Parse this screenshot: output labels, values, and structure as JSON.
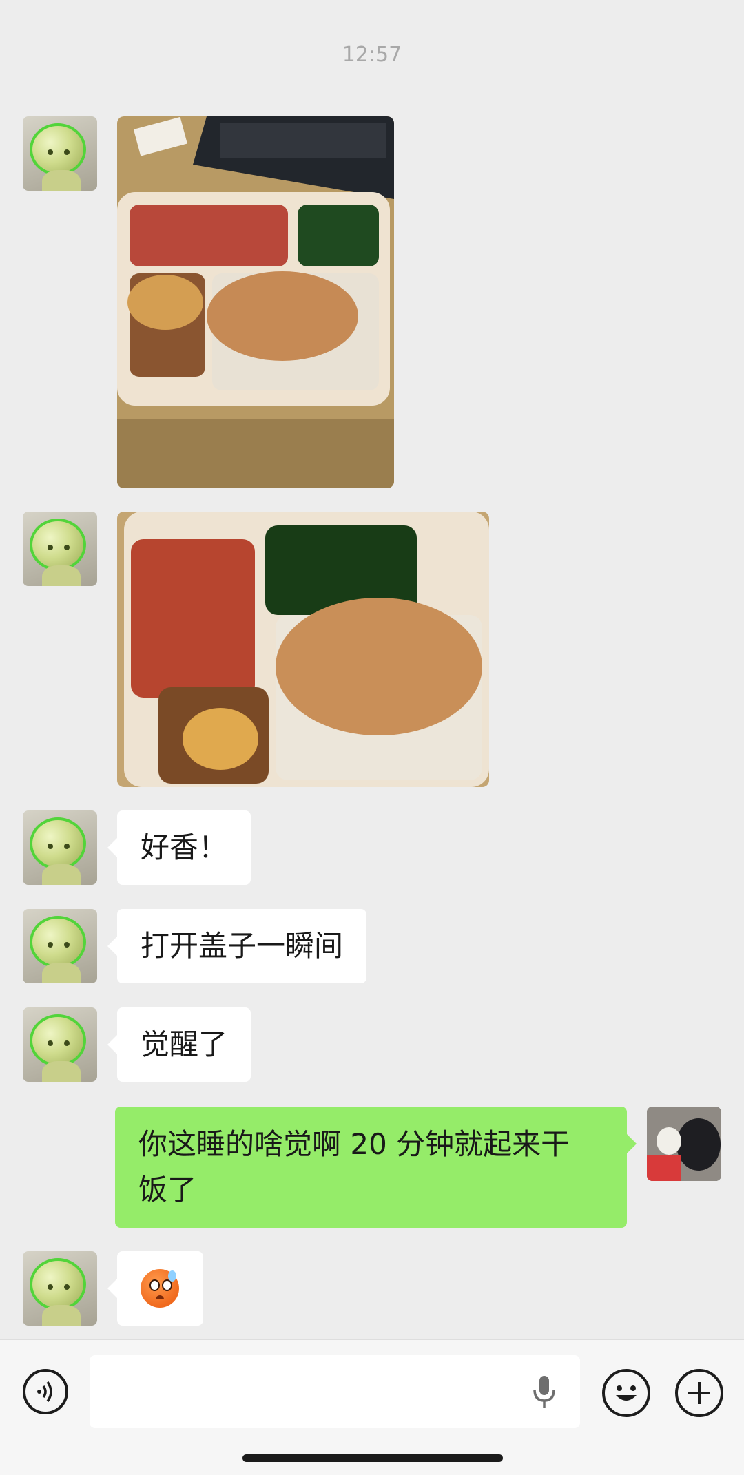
{
  "timestamp": "12:57",
  "messages": [
    {
      "side": "left",
      "type": "image",
      "alt": "food-photo-1"
    },
    {
      "side": "left",
      "type": "image",
      "alt": "food-photo-2"
    },
    {
      "side": "left",
      "type": "text",
      "text": "好香！"
    },
    {
      "side": "left",
      "type": "text",
      "text": "打开盖子一瞬间"
    },
    {
      "side": "left",
      "type": "text",
      "text": "觉醒了"
    },
    {
      "side": "right",
      "type": "text",
      "line1": "你这睡的啥觉啊 20 分钟就起来干",
      "line2": "饭了"
    },
    {
      "side": "left",
      "type": "emoji",
      "icon": "sweat-emoji-icon"
    }
  ],
  "input_bar": {
    "voice_icon": "voice-icon",
    "mic_icon": "microphone-icon",
    "emoji_icon": "emoji-icon",
    "plus_icon": "plus-icon",
    "input_value": ""
  },
  "colors": {
    "background": "#ededed",
    "outgoing_bubble": "#95ec69",
    "incoming_bubble": "#ffffff"
  }
}
